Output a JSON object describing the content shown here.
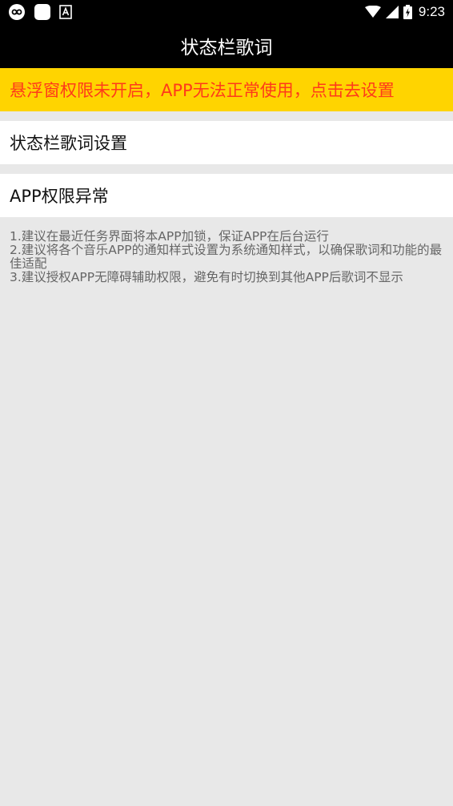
{
  "status_bar": {
    "time": "9:23",
    "icons_left": [
      "infinity-icon",
      "app-square-icon",
      "a-box-icon"
    ],
    "icons_right": [
      "wifi-icon",
      "signal-icon",
      "battery-charging-icon"
    ]
  },
  "header": {
    "title": "状态栏歌词"
  },
  "warning_banner": {
    "text": "悬浮窗权限未开启，APP无法正常使用，点击去设置",
    "bg_color": "#ffd400",
    "text_color": "#ff3a1a"
  },
  "menu": {
    "items": [
      {
        "label": "状态栏歌词设置"
      },
      {
        "label": "APP权限异常"
      }
    ]
  },
  "tips": {
    "lines": [
      "1.建议在最近任务界面将本APP加锁，保证APP在后台运行",
      "2.建议将各个音乐APP的通知样式设置为系统通知样式，以确保歌词和功能的最佳适配",
      "3.建议授权APP无障碍辅助权限，避免有时切换到其他APP后歌词不显示"
    ]
  }
}
